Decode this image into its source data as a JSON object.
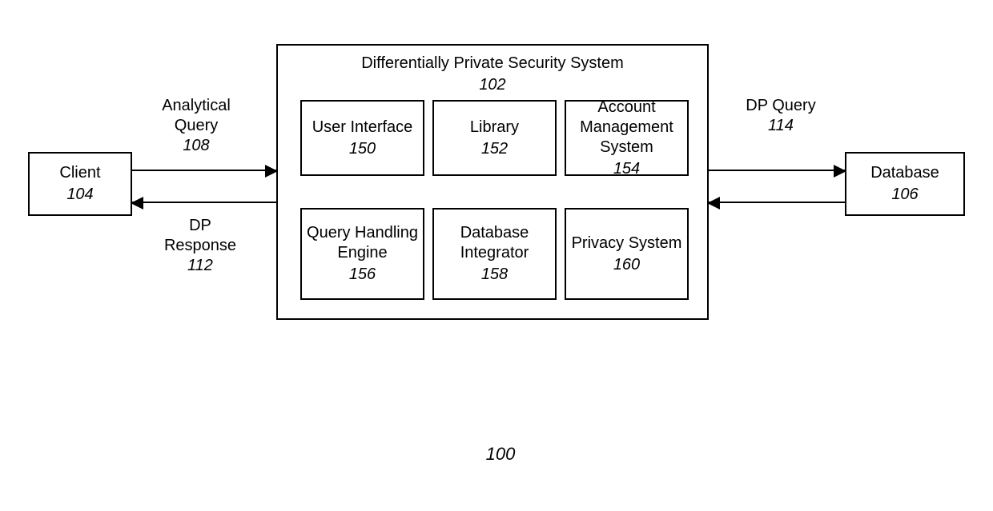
{
  "figure_number": "100",
  "client": {
    "title": "Client",
    "num": "104"
  },
  "database": {
    "title": "Database",
    "num": "106"
  },
  "system": {
    "title": "Differentially Private Security System",
    "num": "102",
    "modules": {
      "user_interface": {
        "title": "User Interface",
        "num": "150"
      },
      "library": {
        "title": "Library",
        "num": "152"
      },
      "account_management": {
        "title": "Account Management System",
        "num": "154"
      },
      "query_handling_engine": {
        "title": "Query Handling Engine",
        "num": "156"
      },
      "database_integrator": {
        "title": "Database Integrator",
        "num": "158"
      },
      "privacy_system": {
        "title": "Privacy System",
        "num": "160"
      }
    }
  },
  "flows": {
    "analytical_query": {
      "title": "Analytical Query",
      "num": "108"
    },
    "dp_response": {
      "title": "DP Response",
      "num": "112"
    },
    "dp_query": {
      "title": "DP Query",
      "num": "114"
    }
  }
}
